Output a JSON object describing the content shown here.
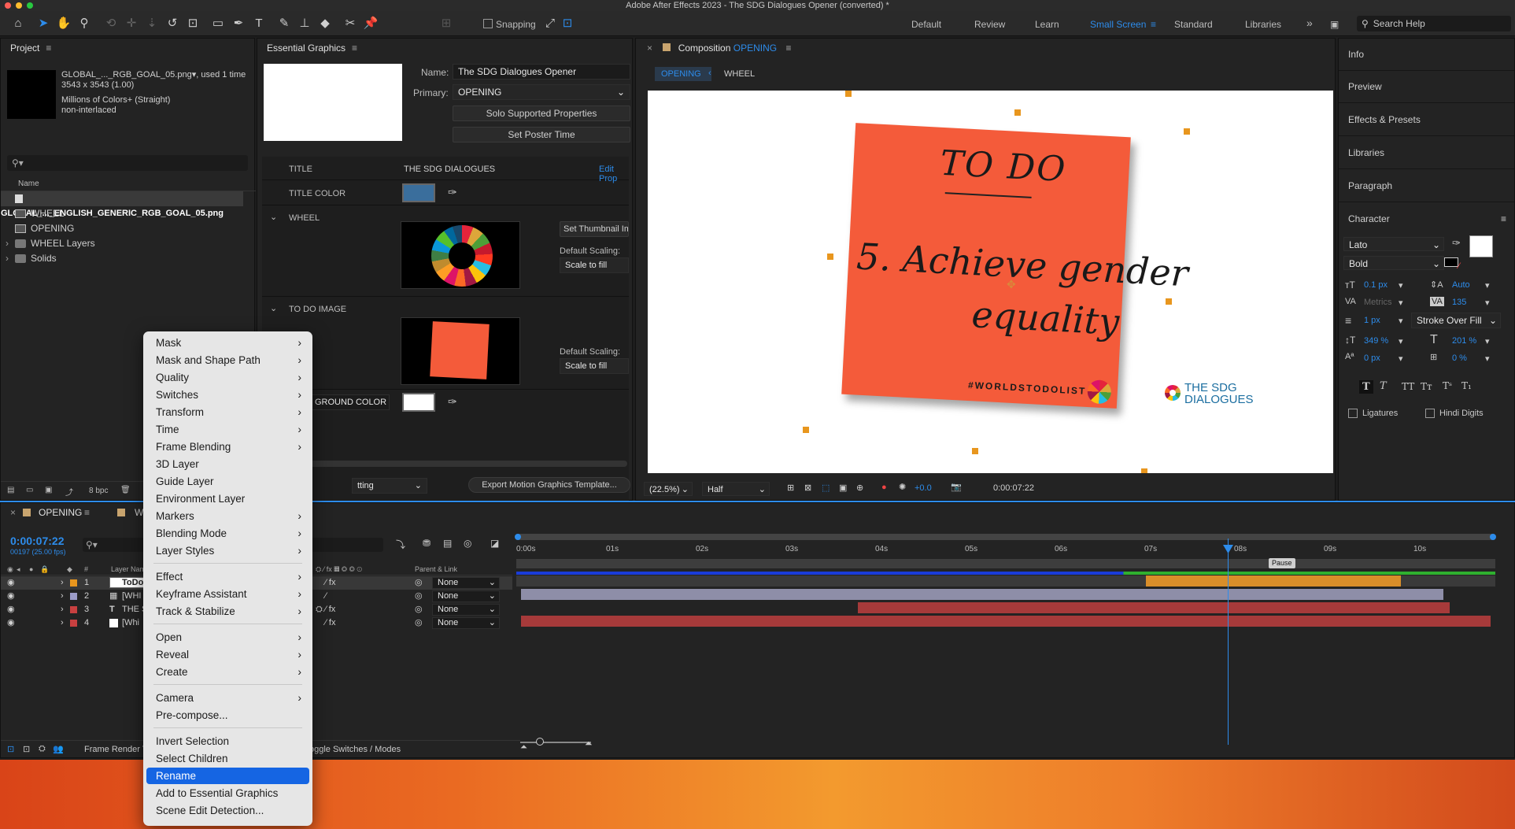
{
  "window": {
    "title": "Adobe After Effects 2023 - The SDG Dialogues Opener (converted) *"
  },
  "toolbar": {
    "snapping": "Snapping",
    "workspaces": [
      "Default",
      "Review",
      "Learn",
      "Small Screen",
      "Standard",
      "Libraries"
    ],
    "active_workspace": "Small Screen",
    "search_placeholder": "Search Help"
  },
  "project": {
    "title": "Project",
    "item_name": "GLOBAL_..._RGB_GOAL_05.png",
    "used": ", used 1 time",
    "dims": "3543 x 3543 (1.00)",
    "colors": "Millions of Colors+ (Straight)",
    "interlace": "non-interlaced",
    "col_name": "Name",
    "items": [
      "GLOBAL_..._ENGLISH_GENERIC_RGB_GOAL_05.png",
      "WHEEL",
      "OPENING",
      "WHEEL Layers",
      "Solids"
    ],
    "bpc": "8 bpc"
  },
  "eg": {
    "title": "Essential Graphics",
    "name_label": "Name:",
    "name_value": "The SDG Dialogues Opener",
    "primary_label": "Primary:",
    "primary_value": "OPENING",
    "solo_btn": "Solo Supported Properties",
    "poster_btn": "Set Poster Time",
    "title_label": "TITLE",
    "title_value": "THE SDG DIALOGUES",
    "edit_prop": "Edit Prop",
    "title_color_label": "TITLE COLOR",
    "wheel_label": "WHEEL",
    "set_thumb": "Set Thumbnail Im",
    "default_scaling": "Default Scaling:",
    "scale_fill": "Scale to fill",
    "todo_label": "TO DO IMAGE",
    "bg_label": "GROUND COLOR",
    "bottom_select": "tting",
    "export_btn": "Export Motion Graphics Template..."
  },
  "comp": {
    "tab_prefix": "Composition",
    "tab_name": "OPENING",
    "crumb_opening": "OPENING",
    "crumb_wheel": "WHEEL",
    "note_title": "TO DO",
    "note_line1": "5. Achieve gender",
    "note_line2": "equality",
    "hashtag": "#WORLDSTODOLIST",
    "logo_line1": "THE SDG",
    "logo_line2": "DIALOGUES",
    "zoom": "(22.5%)",
    "resolution": "Half",
    "exposure": "+0.0",
    "timecode": "0:00:07:22"
  },
  "right_panels": [
    "Info",
    "Preview",
    "Effects & Presets",
    "Libraries",
    "Paragraph",
    "Character"
  ],
  "character": {
    "font": "Lato",
    "style": "Bold",
    "size": "0.1 px",
    "leading": "Auto",
    "kerning": "Metrics",
    "tracking": "135",
    "stroke_width": "1 px",
    "stroke_mode": "Stroke Over Fill",
    "v_scale": "349 %",
    "h_scale": "201 %",
    "baseline": "0 px",
    "tsume": "0 %",
    "ligatures": "Ligatures",
    "hindi_digits": "Hindi Digits",
    "fill_color": "#ffffff",
    "stroke_color": "#000000"
  },
  "timeline": {
    "tab": "OPENING",
    "tab2": "W",
    "timecode": "0:00:07:22",
    "frames": "00197 (25.00 fps)",
    "col_layer": "Layer Name",
    "col_parent": "Parent & Link",
    "layers": [
      {
        "num": "1",
        "name": "ToDo",
        "color": "#e8961e",
        "parent": "None"
      },
      {
        "num": "2",
        "name": "[WHI",
        "color": "#9c9cc8",
        "parent": "None"
      },
      {
        "num": "3",
        "name": "THE S",
        "color": "#c84040",
        "parent": "None"
      },
      {
        "num": "4",
        "name": "[Whi",
        "color": "#c84040",
        "parent": "None"
      }
    ],
    "ticks": [
      "0:00s",
      "01s",
      "02s",
      "03s",
      "04s",
      "05s",
      "06s",
      "07s",
      "08s",
      "09s",
      "10s"
    ],
    "marker": "Pause",
    "footer_left": "Frame Render T",
    "footer_mid": "oggle Switches / Modes"
  },
  "context_menu": {
    "groups": [
      [
        "Mask",
        "Mask and Shape Path",
        "Quality",
        "Switches",
        "Transform",
        "Time",
        "Frame Blending",
        "3D Layer",
        "Guide Layer",
        "Environment Layer",
        "Markers",
        "Blending Mode",
        "Layer Styles"
      ],
      [
        "Effect",
        "Keyframe Assistant",
        "Track & Stabilize"
      ],
      [
        "Open",
        "Reveal",
        "Create"
      ],
      [
        "Camera",
        "Pre-compose..."
      ],
      [
        "Invert Selection",
        "Select Children",
        "Rename",
        "Add to Essential Graphics",
        "Scene Edit Detection..."
      ]
    ],
    "submenu_items": [
      "Mask",
      "Mask and Shape Path",
      "Quality",
      "Switches",
      "Transform",
      "Time",
      "Frame Blending",
      "Markers",
      "Blending Mode",
      "Layer Styles",
      "Effect",
      "Keyframe Assistant",
      "Track & Stabilize",
      "Open",
      "Reveal",
      "Create",
      "Camera"
    ],
    "selected": "Rename"
  },
  "colors": {
    "accent": "#2d8ceb",
    "note": "#f45b3a",
    "selected": "#1565e3",
    "title_swatch": "#3a6e9c"
  }
}
